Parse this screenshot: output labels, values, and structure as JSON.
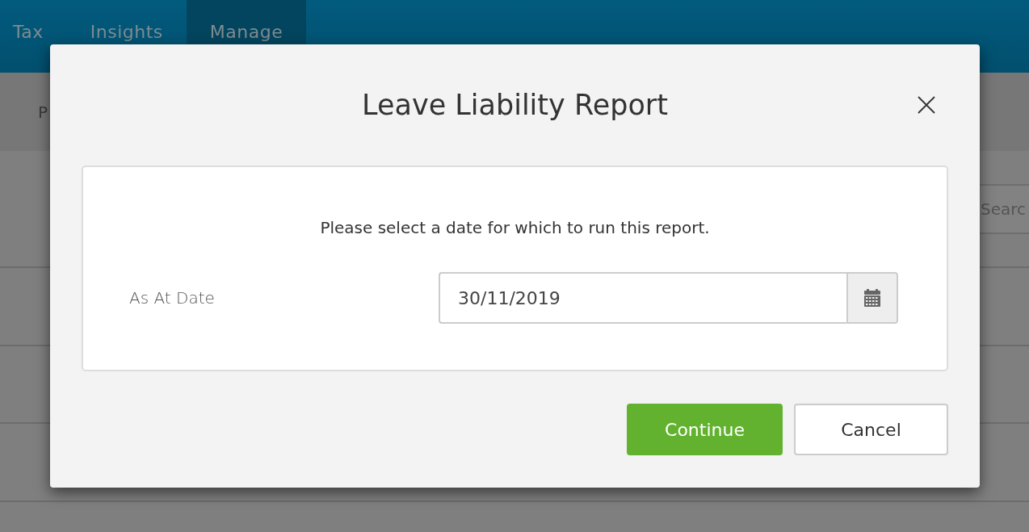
{
  "nav": {
    "tabs": [
      {
        "label": "Tax",
        "selected": false
      },
      {
        "label": "Insights",
        "selected": false
      },
      {
        "label": "Manage",
        "selected": true
      }
    ]
  },
  "subheader": {
    "text": "P"
  },
  "search": {
    "placeholder": "Searc"
  },
  "dialog": {
    "title": "Leave Liability Report",
    "instruction": "Please select a date for which to run this report.",
    "field": {
      "label": "As At Date",
      "value": "30/11/2019"
    },
    "buttons": [
      {
        "label": "Continue",
        "kind": "primary"
      },
      {
        "label": "Cancel",
        "kind": "secondary"
      }
    ]
  }
}
